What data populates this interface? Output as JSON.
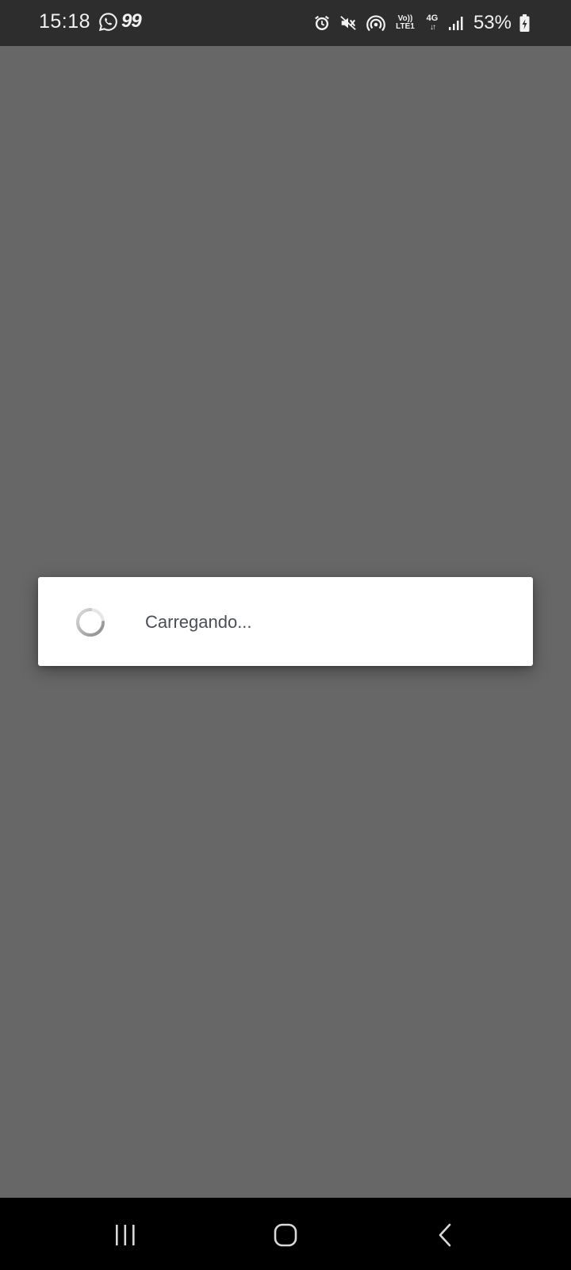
{
  "status_bar": {
    "time": "15:18",
    "notification_badge": "99",
    "volte_top": "Vo))",
    "volte_bottom": "LTE1",
    "network_type": "4G",
    "network_arrows": "↓↑",
    "battery_percent": "53%",
    "icons": [
      "whatsapp-icon",
      "alarm-icon",
      "mute-icon",
      "hotspot-icon",
      "signal-icon",
      "battery-charging-icon"
    ]
  },
  "dialog": {
    "message": "Carregando..."
  },
  "colors": {
    "overlay": "#676767",
    "status_bar_bg": "#2d2d2d",
    "nav_bar_bg": "#000000",
    "dialog_bg": "#ffffff",
    "text": "#4a4f55"
  },
  "nav_bar": {
    "buttons": [
      "recents-icon",
      "home-icon",
      "back-icon"
    ]
  }
}
